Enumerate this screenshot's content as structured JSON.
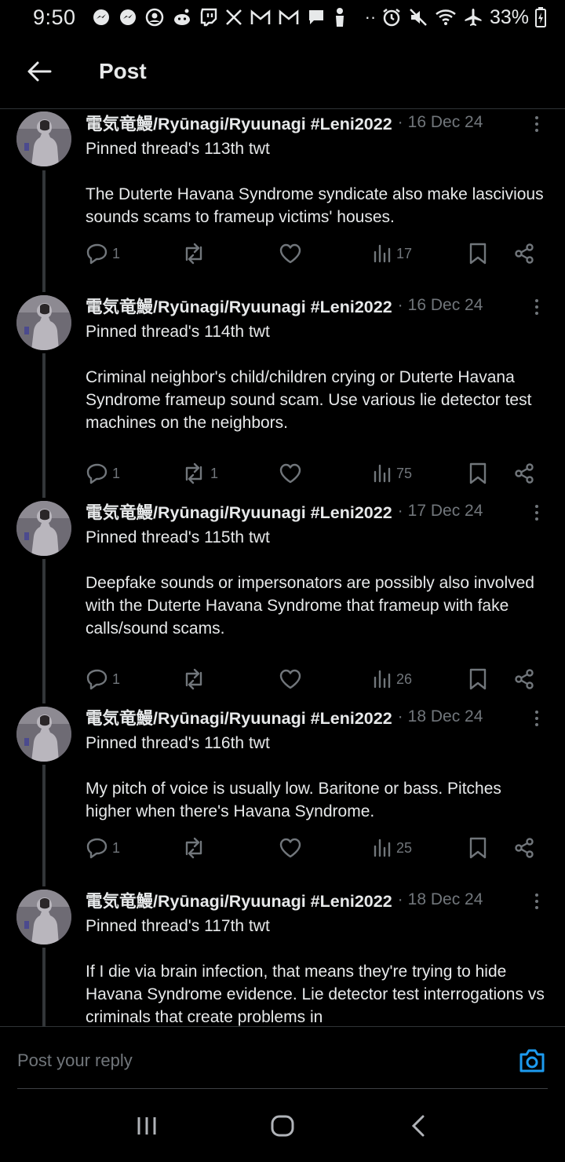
{
  "status_bar": {
    "time": "9:50",
    "notification_icons": [
      "messenger-icon",
      "messenger-icon",
      "avatar-circle-icon",
      "reddit-icon",
      "twitch-icon",
      "x-icon",
      "gmail-icon",
      "gmail-icon",
      "chat-icon",
      "figure-icon",
      "more-dots-icon"
    ],
    "battery": "33%"
  },
  "header": {
    "title": "Post"
  },
  "posts": [
    {
      "author": "電気竜鰻/Ryūnagi/Ryuunagi #Leni2022",
      "date": "16 Dec 24",
      "text": "Pinned thread's 113th twt\n\nThe Duterte Havana Syndrome syndicate also make lascivious sounds scams to frameup victims' houses.",
      "replies": "1",
      "reposts": "",
      "views": "17"
    },
    {
      "author": "電気竜鰻/Ryūnagi/Ryuunagi #Leni2022",
      "date": "16 Dec 24",
      "text": "Pinned thread's 114th twt\n\nCriminal neighbor's child/children crying or Duterte Havana Syndrome frameup sound scam. Use various lie detector test machines on the neighbors.",
      "replies": "1",
      "reposts": "1",
      "views": "75"
    },
    {
      "author": "電気竜鰻/Ryūnagi/Ryuunagi #Leni2022",
      "date": "17 Dec 24",
      "text": "Pinned thread's 115th twt\n\nDeepfake sounds or impersonators are possibly also involved with the Duterte Havana Syndrome that frameup with fake calls/sound scams.",
      "replies": "1",
      "reposts": "",
      "views": "26"
    },
    {
      "author": "電気竜鰻/Ryūnagi/Ryuunagi #Leni2022",
      "date": "18 Dec 24",
      "text": "Pinned thread's 116th twt\n\nMy pitch of voice is usually low. Baritone or bass. Pitches higher when there's Havana Syndrome.",
      "replies": "1",
      "reposts": "",
      "views": "25"
    },
    {
      "author": "電気竜鰻/Ryūnagi/Ryuunagi #Leni2022",
      "date": "18 Dec 24",
      "text": "Pinned thread's 117th twt\n\nIf I die via brain infection, that means they're trying to hide Havana Syndrome evidence. Lie detector test interrogations vs  criminals that create problems in",
      "replies": "",
      "reposts": "",
      "views": ""
    }
  ],
  "reply_bar": {
    "placeholder": "Post your reply"
  },
  "colors": {
    "background": "#000000",
    "text": "#e7e9ea",
    "muted": "#71767b",
    "accent": "#1d9bf0",
    "divider": "#2f3336"
  }
}
